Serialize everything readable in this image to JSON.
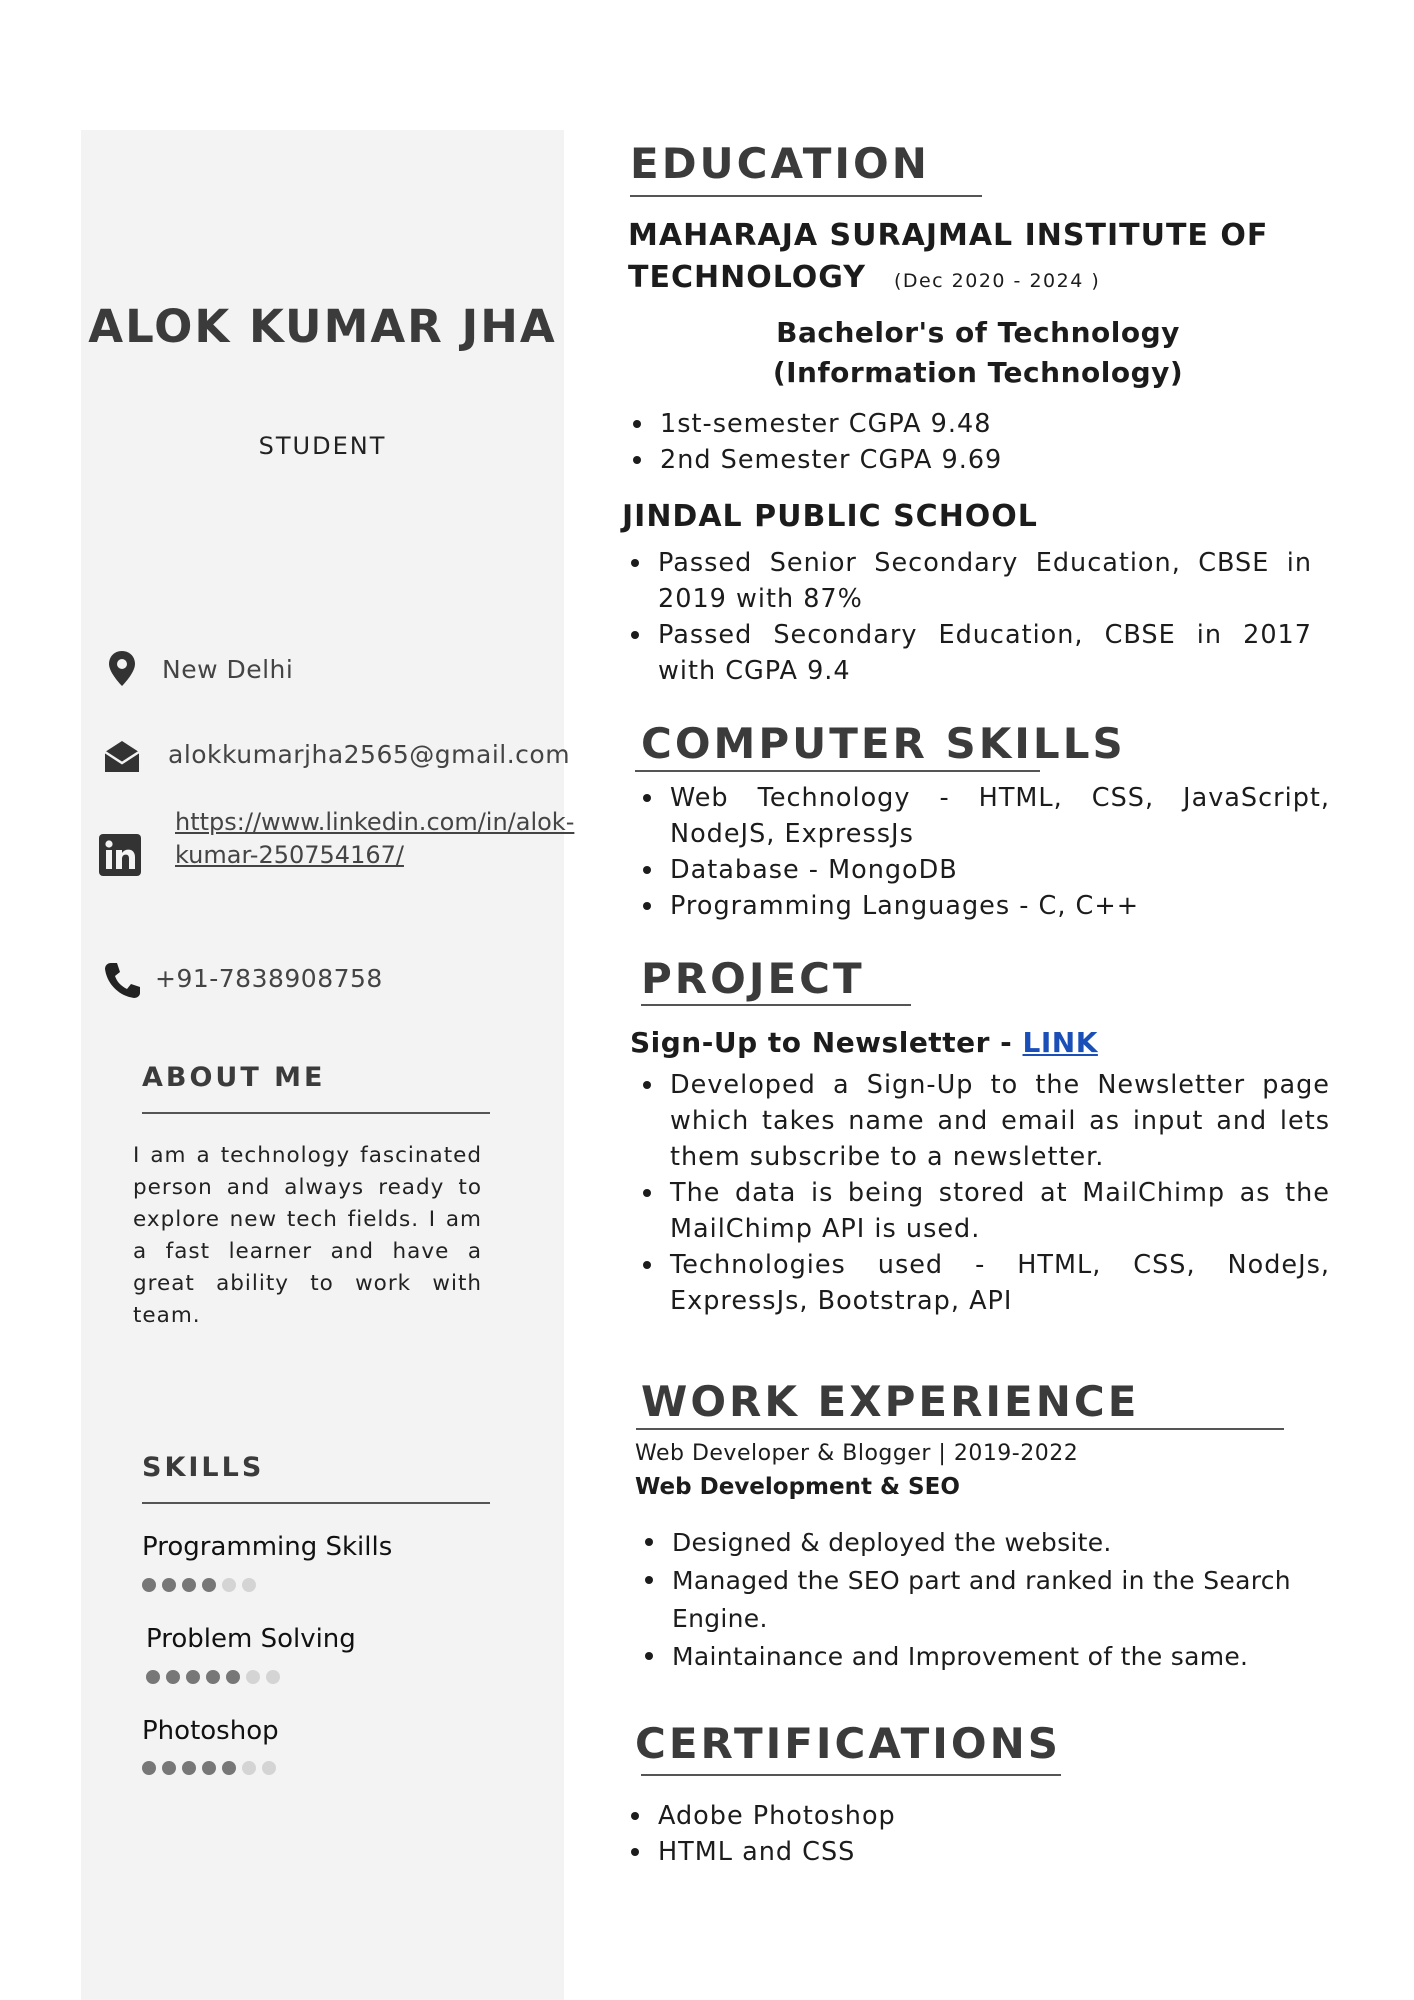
{
  "profile": {
    "name": "ALOK KUMAR JHA",
    "role": "STUDENT"
  },
  "contact": {
    "location": "New Delhi",
    "email": "alokkumarjha2565@gmail.com",
    "linkedin": "https://www.linkedin.com/in/alok-kumar-250754167/",
    "phone": "+91-7838908758"
  },
  "about": {
    "heading": "ABOUT ME",
    "text": "I am a technology fascinated person and always ready to explore new tech fields. I am a fast learner and have a great ability to work with team."
  },
  "skills": {
    "heading": "SKILLS",
    "items": [
      {
        "label": "Programming Skills",
        "level": 4,
        "max": 6
      },
      {
        "label": "Problem Solving",
        "level": 5,
        "max": 7
      },
      {
        "label": "Photoshop",
        "level": 5,
        "max": 7
      }
    ]
  },
  "education": {
    "heading": "EDUCATION",
    "college": {
      "name_line1": "MAHARAJA SURAJMAL INSTITUTE OF",
      "name_line2": "TECHNOLOGY",
      "dates": "(Dec 2020 - 2024 )",
      "degree_line1": "Bachelor's of Technology",
      "degree_line2": "(Information Technology)",
      "bullets": [
        "1st-semester CGPA 9.48",
        "2nd Semester CGPA 9.69"
      ]
    },
    "school": {
      "name": "JINDAL PUBLIC SCHOOL",
      "bullets": [
        "Passed Senior Secondary Education, CBSE in 2019 with 87%",
        "Passed Secondary Education, CBSE in 2017 with CGPA 9.4"
      ]
    }
  },
  "computer_skills": {
    "heading": "COMPUTER SKILLS",
    "bullets": [
      "Web Technology - HTML, CSS, JavaScript, NodeJS, ExpressJs",
      "Database - MongoDB",
      "Programming Languages - C, C++"
    ]
  },
  "project": {
    "heading": "PROJECT",
    "title": "Sign-Up to Newsletter",
    "separator": " - ",
    "link_label": "LINK",
    "bullets": [
      "Developed a Sign-Up to the Newsletter page which takes name and email as input and lets them subscribe to a newsletter.",
      "The data is being stored at MailChimp as the MailChimp API is used.",
      "Technologies used - HTML, CSS, NodeJs, ExpressJs, Bootstrap, API"
    ]
  },
  "work": {
    "heading": "WORK EXPERIENCE",
    "role_line": "Web Developer & Blogger | 2019-2022",
    "focus": "Web Development & SEO",
    "bullets": [
      "Designed & deployed the website.",
      "Managed the SEO part and ranked in the Search Engine.",
      "Maintainance and Improvement of the same."
    ]
  },
  "certifications": {
    "heading": "CERTIFICATIONS",
    "bullets": [
      "Adobe Photoshop",
      "HTML and CSS"
    ]
  },
  "icons": [
    "location-pin-icon",
    "email-icon",
    "linkedin-icon",
    "phone-icon"
  ]
}
